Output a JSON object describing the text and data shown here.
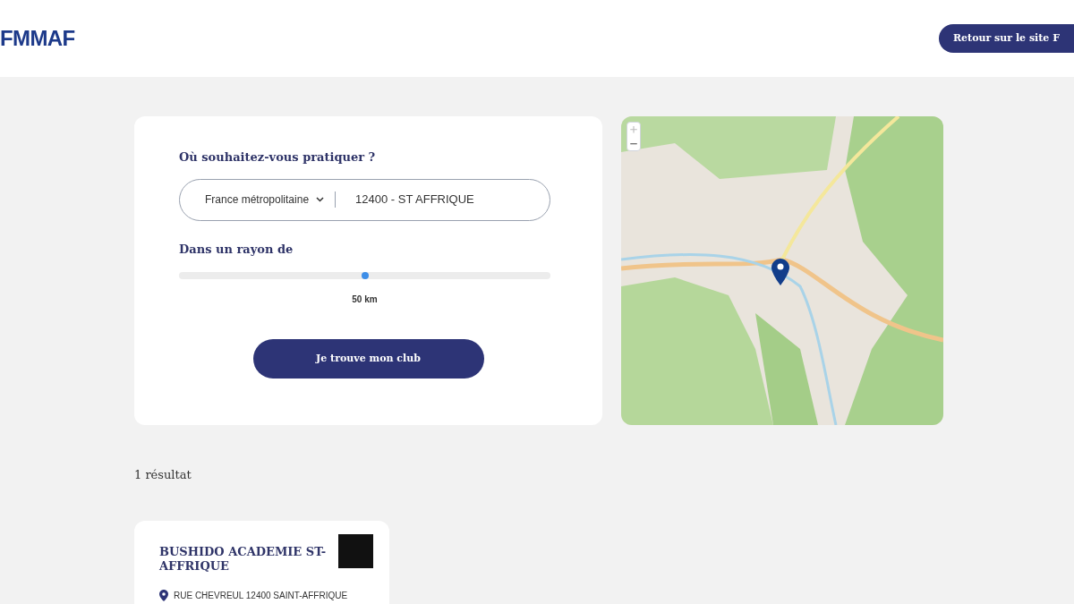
{
  "header": {
    "logo": "FMMAF",
    "back_button": "Retour sur le site F"
  },
  "search": {
    "question": "Où souhaitez-vous pratiquer ?",
    "region": "France métropolitaine",
    "location": "12400 - ST AFFRIQUE",
    "radius_label": "Dans un rayon de",
    "radius": {
      "level": 0.5,
      "reading": "50 km"
    },
    "submit": "Je trouve mon club"
  },
  "results": {
    "count": "1 résultat",
    "clubs": [
      {
        "name": "BUSHIDO ACADEMIE ST-AFFRIQUE",
        "address": "RUE CHEVREUL 12400 SAINT-AFFRIQUE"
      }
    ]
  }
}
